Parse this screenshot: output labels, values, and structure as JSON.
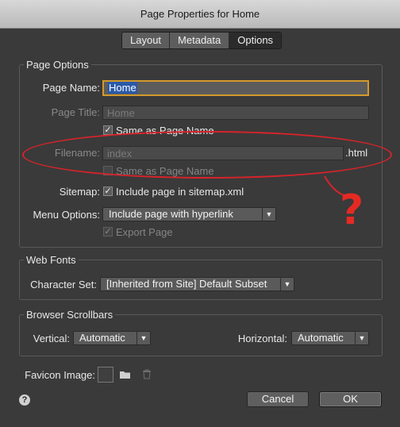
{
  "window": {
    "title": "Page Properties for Home"
  },
  "tabs": [
    {
      "label": "Layout",
      "active": false
    },
    {
      "label": "Metadata",
      "active": false
    },
    {
      "label": "Options",
      "active": true
    }
  ],
  "page_options": {
    "legend": "Page Options",
    "page_name": {
      "label": "Page Name:",
      "value": "Home"
    },
    "page_title": {
      "label": "Page Title:",
      "value": "",
      "placeholder": "Home"
    },
    "same_as_page_name_title": {
      "label": "Same as Page Name",
      "checked": true
    },
    "filename": {
      "label": "Filename:",
      "value": "",
      "placeholder": "index",
      "suffix": ".html"
    },
    "same_as_page_name_file": {
      "label": "Same as Page Name",
      "checked": false
    },
    "sitemap": {
      "label": "Sitemap:",
      "checkbox_label": "Include page in sitemap.xml",
      "checked": true
    },
    "menu_options": {
      "label": "Menu Options:",
      "selected": "Include page with hyperlink"
    },
    "export_page": {
      "label": "Export Page",
      "checked": true
    }
  },
  "web_fonts": {
    "legend": "Web Fonts",
    "character_set": {
      "label": "Character Set:",
      "selected": "[Inherited from Site] Default Subset"
    }
  },
  "browser_scrollbars": {
    "legend": "Browser Scrollbars",
    "vertical": {
      "label": "Vertical:",
      "selected": "Automatic"
    },
    "horizontal": {
      "label": "Horizontal:",
      "selected": "Automatic"
    }
  },
  "favicon": {
    "label": "Favicon Image:"
  },
  "footer": {
    "cancel_label": "Cancel",
    "ok_label": "OK",
    "help_icon": "?"
  },
  "annotation": {
    "mark": "?",
    "color": "#e52a23"
  },
  "icons": {
    "check": "✓",
    "arrow": "▼",
    "folder": "folder-icon",
    "trash": "trash-icon"
  }
}
